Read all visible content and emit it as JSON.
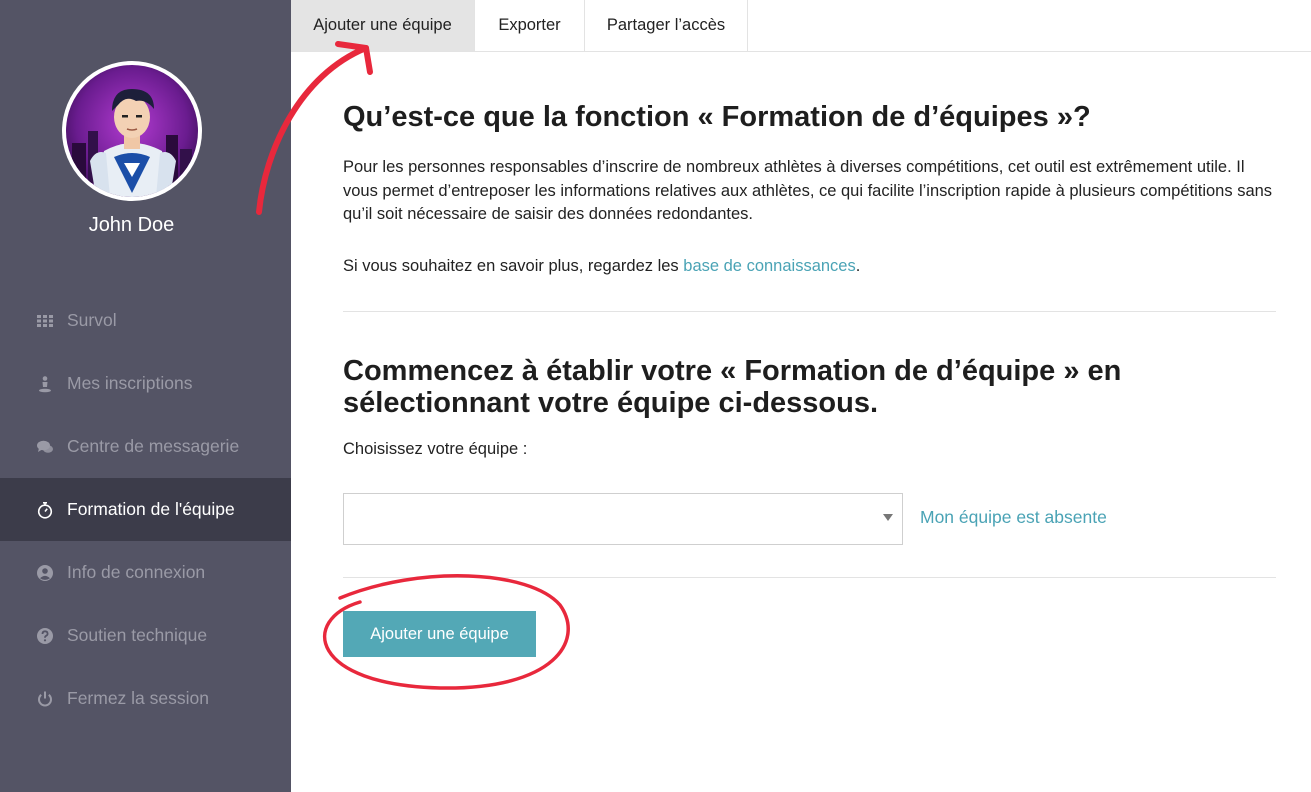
{
  "user": {
    "name": "John Doe"
  },
  "sidebar": {
    "items": [
      {
        "label": "Survol",
        "icon": "grid-icon",
        "active": false
      },
      {
        "label": "Mes inscriptions",
        "icon": "person-icon",
        "active": false
      },
      {
        "label": "Centre de messagerie",
        "icon": "chat-icon",
        "active": false
      },
      {
        "label": "Formation de l'équipe",
        "icon": "stopwatch-icon",
        "active": true
      },
      {
        "label": "Info de connexion",
        "icon": "user-circle-icon",
        "active": false
      },
      {
        "label": "Soutien technique",
        "icon": "question-icon",
        "active": false
      },
      {
        "label": "Fermez la session",
        "icon": "power-icon",
        "active": false
      }
    ]
  },
  "tabs": [
    {
      "label": "Ajouter une équipe",
      "active": true
    },
    {
      "label": "Exporter",
      "active": false
    },
    {
      "label": "Partager l’accès",
      "active": false
    }
  ],
  "main": {
    "heading": "Qu’est-ce que la fonction « Formation de d’équipes »?",
    "intro": "Pour les personnes responsables d’inscrire de nombreux athlètes à diverses compétitions, cet outil est extrêmement utile. Il vous permet d’entreposer les informations relatives aux athlètes, ce qui facilite l’inscription rapide à plusieurs compétitions sans qu’il soit nécessaire de saisir des données redondantes.",
    "more_prefix": "Si vous souhaitez en savoir plus, regardez les ",
    "more_link": "base de connaissances",
    "more_suffix": ".",
    "heading2": "Commencez à établir votre « Formation de d’équipe » en sélectionnant votre équipe ci-dessous.",
    "select_label": "Choisissez votre équipe :",
    "select_value": "",
    "absent_link": "Mon équipe est absente",
    "add_button": "Ajouter une équipe"
  },
  "colors": {
    "sidebar_bg": "#545465",
    "sidebar_active_bg": "#3c3c4a",
    "accent": "#53a8b6",
    "link": "#4aa3b5",
    "annotation": "#e8283c"
  }
}
